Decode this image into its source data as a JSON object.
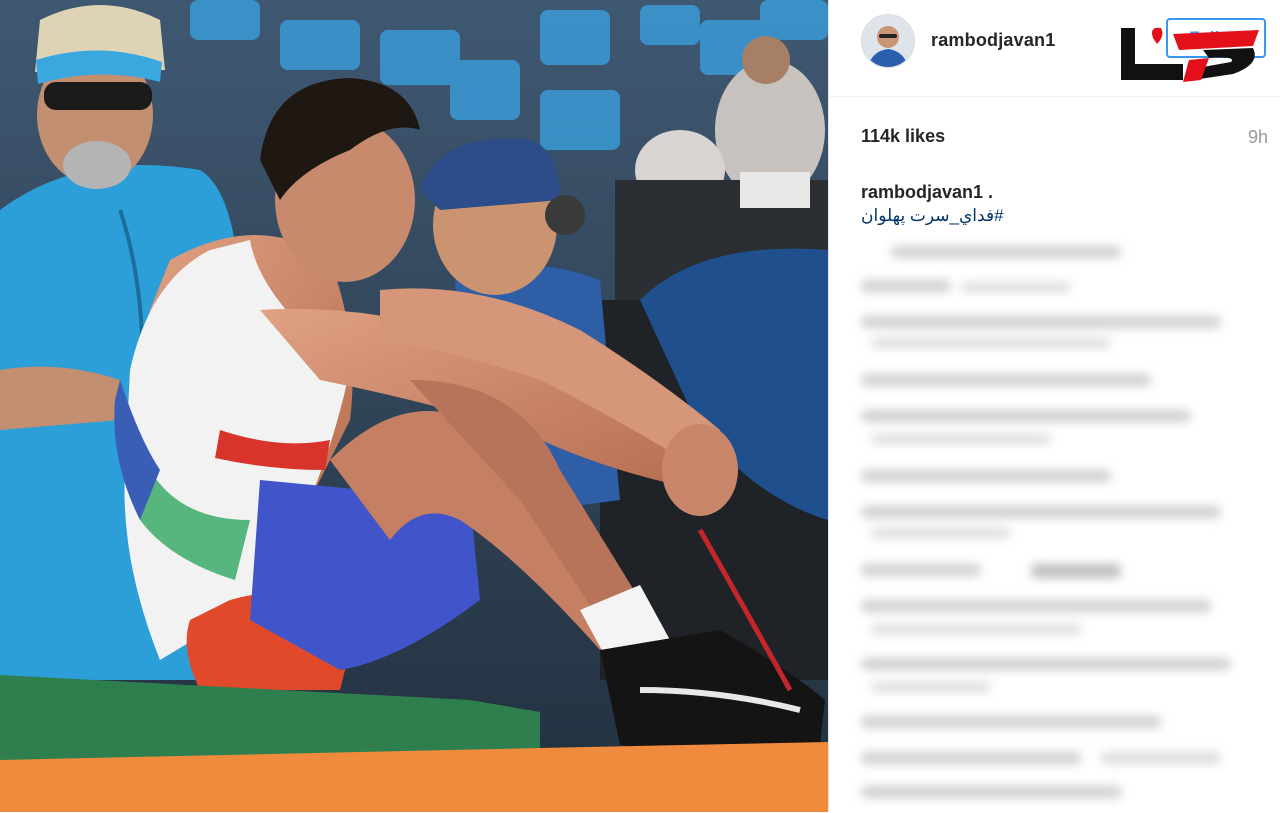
{
  "post": {
    "username": "rambodjavan1",
    "follow_label": "Follow",
    "likes": "114k likes",
    "time_ago": "9h",
    "caption_username": "rambodjavan1 .",
    "caption_hashtag": "#فداي_سرت پهلوان"
  },
  "colors": {
    "follow_blue": "#3897f0",
    "logo_red": "#e3101c",
    "logo_black": "#111111",
    "mat_green": "#2f7f4e",
    "floor_orange": "#f08a3c",
    "seat_blue": "#3a9bd6"
  },
  "icons": {
    "logo": "site-watermark-logo",
    "avatar": "profile-avatar"
  }
}
